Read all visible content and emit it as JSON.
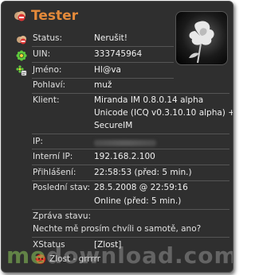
{
  "header": {
    "title": "Tester"
  },
  "fields": {
    "status_label": "Status:",
    "status_value": "Nerušit!",
    "uin_label": "UIN:",
    "uin_value": "333745964",
    "name_label": "Jméno:",
    "name_value": "Hl@va",
    "gender_label": "Pohlaví:",
    "gender_value": "muž",
    "client_label": "Klient:",
    "client_line1": "Miranda IM 0.8.0.14 alpha",
    "client_line2": "Unicode (ICQ v0.3.10.10 alpha) +",
    "client_line3": "SecureIM",
    "ip_label": "IP:",
    "internal_ip_label": "Interní IP:",
    "internal_ip_value": "192.168.2.100",
    "login_label": "Přihlášení:",
    "login_value": "22:58:53 (před: 5 min.)",
    "last_status_label": "Poslední stav:",
    "last_status_line1": "28.5.2008 @ 22:59:16",
    "last_status_line2": "Online (před: 5 min.)",
    "message_label": "Zpráva stavu:",
    "message_value": "Nechte mě prosím chvíli o samotě, ano?",
    "xstatus_label": "XStatus",
    "xstatus_value": "[Zlost]",
    "xstatus_detail": "Zlost - grrrrr"
  },
  "watermark": {
    "first": "me",
    "rest": "download.com"
  },
  "icons": {
    "title": "status-dnd-icon",
    "uin": "icq-flower-icon",
    "name": "contact-icon",
    "xstatus": "angry-face-icon"
  },
  "colors": {
    "title": "#e48a3a",
    "background": "#2f2f2f",
    "text": "#eeeeee",
    "icq_green": "#5ec93c"
  }
}
